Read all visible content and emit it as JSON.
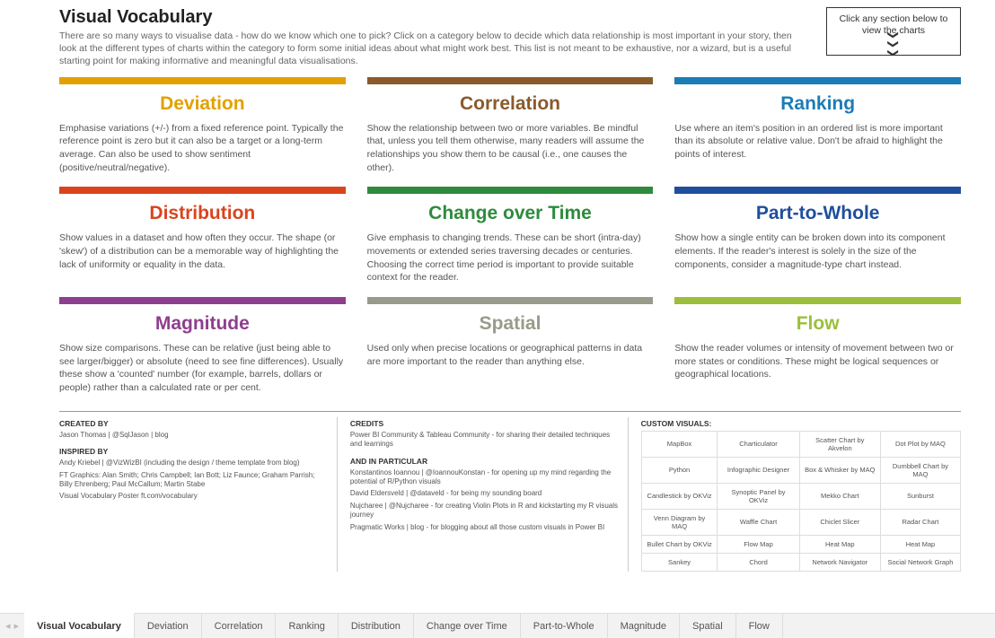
{
  "header": {
    "title": "Visual Vocabulary",
    "subtitle": "There are so many ways to visualise data - how do we know which one to pick? Click on a category below to decide which data relationship is most important in your story, then look at the different types of charts within the category to form some initial ideas about what might work best. This list is not meant to be exhaustive, nor a wizard, but is a useful starting point for making informative and meaningful data visualisations.",
    "hint": "Click any section below to view the charts",
    "hint_arrows": "❯❯❯"
  },
  "cards": [
    {
      "title": "Deviation",
      "color": "#e2a100",
      "desc": "Emphasise variations (+/-) from a fixed reference point. Typically the reference point is zero but it can also be a target or a long-term average. Can also be used to show sentiment (positive/neutral/negative)."
    },
    {
      "title": "Correlation",
      "color": "#8a5a2b",
      "desc": "Show the relationship between two or more variables. Be mindful that, unless you tell them otherwise, many readers will assume the relationships you show them to be causal (i.e., one causes the other)."
    },
    {
      "title": "Ranking",
      "color": "#1c7cb5",
      "desc": "Use where an item's position in an ordered list is more important than its absolute or relative value. Don't be afraid to highlight the points of interest."
    },
    {
      "title": "Distribution",
      "color": "#d9441e",
      "desc": "Show values in a dataset and how often they occur. The shape (or 'skew') of a distribution can be a memorable way of highlighting the lack of uniformity or equality in the data."
    },
    {
      "title": "Change over Time",
      "color": "#2e8b3d",
      "desc": "Give emphasis to changing trends. These can be short (intra-day) movements or extended series traversing decades or centuries. Choosing the correct time period is important to provide suitable context for the reader."
    },
    {
      "title": "Part-to-Whole",
      "color": "#1f4f9c",
      "desc": "Show how a single entity can be broken down into its component elements. If the reader's interest is solely in the size of the components, consider a magnitude-type chart instead."
    },
    {
      "title": "Magnitude",
      "color": "#8e3e8e",
      "desc": "Show size comparisons. These can be relative (just being able to see larger/bigger) or absolute (need to see fine differences). Usually these show a 'counted' number (for example, barrels, dollars or people) rather than a calculated rate or per cent."
    },
    {
      "title": "Spatial",
      "color": "#9a9a8a",
      "desc": "Used only when precise locations or geographical patterns in data are more important to the reader than anything else."
    },
    {
      "title": "Flow",
      "color": "#9bbf3b",
      "desc": "Show the reader volumes or intensity of movement between two or more states or conditions. These might be logical sequences or geographical locations."
    }
  ],
  "footer": {
    "col1": {
      "created_head": "CREATED BY",
      "created_line": "Jason Thomas | @SqlJason | blog",
      "inspired_head": "INSPIRED BY",
      "inspired_lines": [
        "Andy Kriebel | @VizWizBI (including the design / theme template from blog)",
        "FT Graphics: Alan Smith; Chris Campbell; Ian Bott; Liz Faunce; Graham Parrish; Billy Ehrenberg; Paul McCallum; Martin Stabe",
        "Visual Vocabulary Poster ft.com/vocabulary"
      ]
    },
    "col2": {
      "credits_head": "CREDITS",
      "credits_line": "Power BI Community & Tableau Community - for sharing their detailed techniques and learnings",
      "particular_head": "AND IN PARTICULAR",
      "particular_lines": [
        "Konstantinos Ioannou | @IoannouKonstan - for opening up my mind regarding the potential of R/Python visuals",
        "David Eldersveld | @dataveld - for being my sounding board",
        "Nujcharee | @Nujcharee - for creating Violin Plots in R and kickstarting my R visuals journey",
        "Pragmatic Works | blog - for blogging about all those custom visuals in Power BI"
      ]
    },
    "col3": {
      "head": "CUSTOM VISUALS:",
      "rows": [
        [
          "MapBox",
          "Charticulator",
          "Scatter Chart by Akvelon",
          "Dot Plot by MAQ"
        ],
        [
          "Python",
          "Infographic Designer",
          "Box & Whisker by MAQ",
          "Dumbbell Chart by MAQ"
        ],
        [
          "Candlestick by OKViz",
          "Synoptic Panel by OKViz",
          "Mekko Chart",
          "Sunburst"
        ],
        [
          "Venn Diagram by MAQ",
          "Waffle Chart",
          "Chiclet Slicer",
          "Radar Chart"
        ],
        [
          "Bullet Chart by OKViz",
          "Flow Map",
          "Heat Map",
          "Heat Map"
        ],
        [
          "Sankey",
          "Chord",
          "Network Navigator",
          "Social Network Graph"
        ]
      ]
    }
  },
  "tabs": {
    "items": [
      "Visual Vocabulary",
      "Deviation",
      "Correlation",
      "Ranking",
      "Distribution",
      "Change over Time",
      "Part-to-Whole",
      "Magnitude",
      "Spatial",
      "Flow"
    ],
    "active": "Visual Vocabulary"
  }
}
